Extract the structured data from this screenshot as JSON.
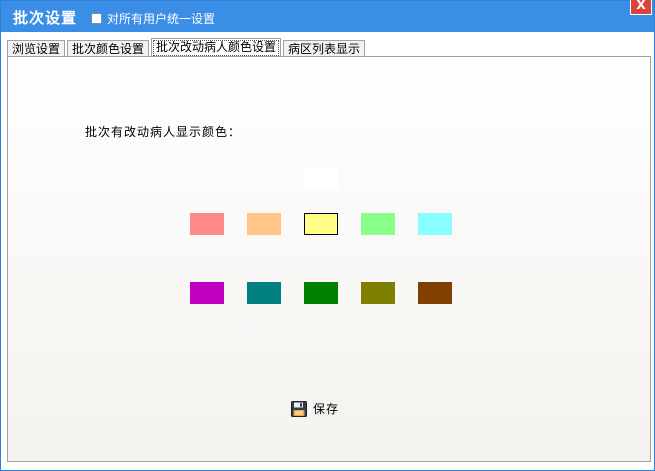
{
  "window": {
    "title": "批次设置",
    "sync_all_users_label": "对所有用户统一设置",
    "sync_all_users_checked": false,
    "close_label": "X"
  },
  "tabs": [
    {
      "label": "浏览设置",
      "active": false
    },
    {
      "label": "批次颜色设置",
      "active": false
    },
    {
      "label": "批次改动病人颜色设置",
      "active": true
    },
    {
      "label": "病区列表显示",
      "active": false
    }
  ],
  "panel": {
    "heading": "批次有改动病人显示颜色：",
    "colors": [
      {
        "id": "white",
        "hex": "#ffffff",
        "selected": false
      },
      {
        "id": "salmon",
        "hex": "#ff8888",
        "selected": false
      },
      {
        "id": "peach",
        "hex": "#ffc68a",
        "selected": false
      },
      {
        "id": "light-yellow",
        "hex": "#ffff88",
        "selected": true
      },
      {
        "id": "light-green",
        "hex": "#88ff88",
        "selected": false
      },
      {
        "id": "light-cyan",
        "hex": "#88ffff",
        "selected": false
      },
      {
        "id": "magenta",
        "hex": "#c000c0",
        "selected": false
      },
      {
        "id": "teal",
        "hex": "#008080",
        "selected": false
      },
      {
        "id": "green",
        "hex": "#008000",
        "selected": false
      },
      {
        "id": "olive",
        "hex": "#808000",
        "selected": false
      },
      {
        "id": "brown",
        "hex": "#804000",
        "selected": false
      }
    ],
    "save_label": "保存",
    "save_icon": "floppy-disk-icon"
  },
  "theme": {
    "titlebar": "#3b8ee6",
    "close": "#d9453b"
  }
}
